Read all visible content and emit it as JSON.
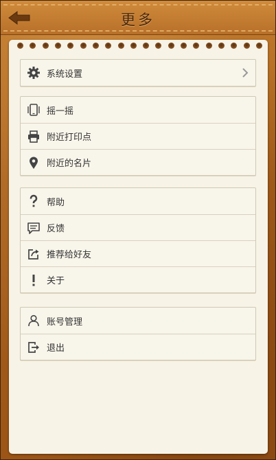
{
  "header": {
    "title": "更多",
    "back_icon": "back-arrow-icon"
  },
  "groups": [
    {
      "items": [
        {
          "label": "系统设置",
          "icon": "gear-icon",
          "has_chevron": true
        }
      ]
    },
    {
      "items": [
        {
          "label": "摇一摇",
          "icon": "shake-phone-icon"
        },
        {
          "label": "附近打印点",
          "icon": "printer-icon"
        },
        {
          "label": "附近的名片",
          "icon": "location-pin-icon"
        }
      ]
    },
    {
      "items": [
        {
          "label": "帮助",
          "icon": "question-icon"
        },
        {
          "label": "反馈",
          "icon": "feedback-icon"
        },
        {
          "label": "推荐给好友",
          "icon": "share-icon"
        },
        {
          "label": "关于",
          "icon": "exclamation-icon"
        }
      ]
    },
    {
      "items": [
        {
          "label": "账号管理",
          "icon": "user-icon"
        },
        {
          "label": "退出",
          "icon": "logout-icon"
        }
      ]
    }
  ],
  "colors": {
    "leather": "#a9601c",
    "header": "#c27c30",
    "paper": "#f7f3e6",
    "title_text": "#4a2608",
    "icon": "#444444"
  }
}
